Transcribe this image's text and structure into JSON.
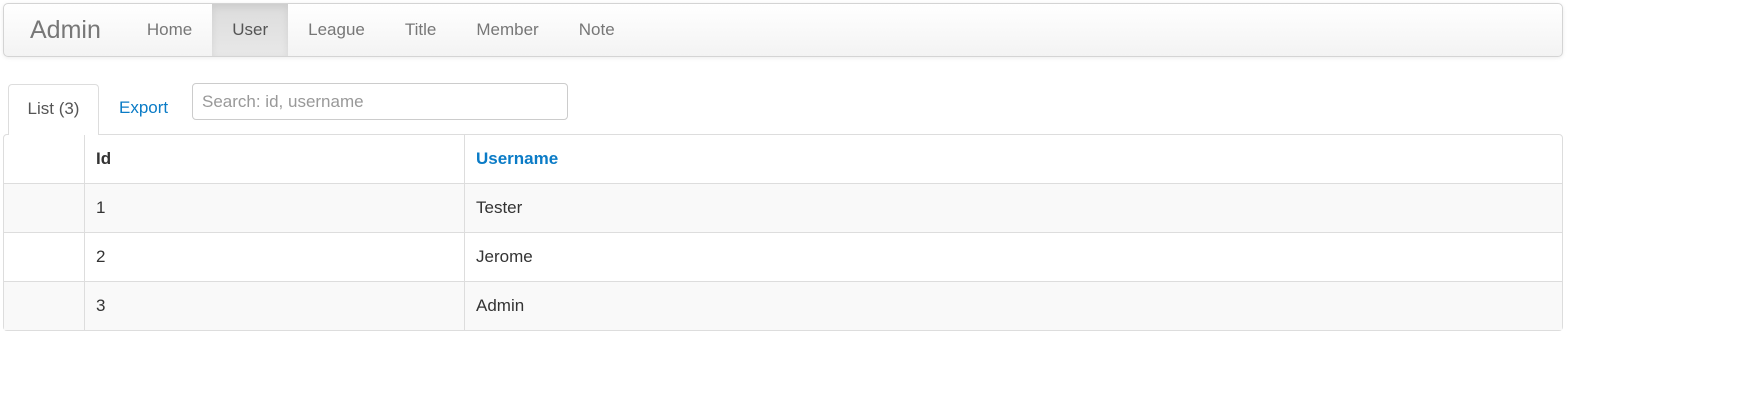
{
  "navbar": {
    "brand": "Admin",
    "items": [
      "Home",
      "User",
      "League",
      "Title",
      "Member",
      "Note"
    ],
    "active": "User"
  },
  "tabs": {
    "list": "List (3)",
    "export": "Export"
  },
  "search": {
    "placeholder": "Search: id, username",
    "value": ""
  },
  "table": {
    "headers": [
      "",
      "Id",
      "Username"
    ],
    "rows": [
      [
        "1",
        "Tester"
      ],
      [
        "2",
        "Jerome"
      ],
      [
        "3",
        "Admin"
      ]
    ]
  }
}
